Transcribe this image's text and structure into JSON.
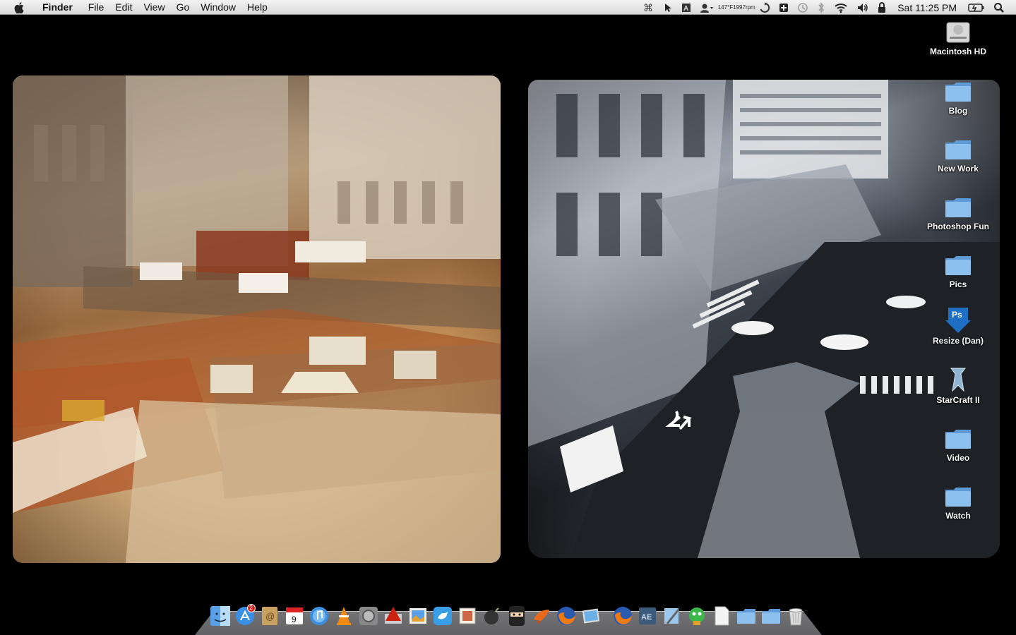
{
  "menubar": {
    "app_name": "Finder",
    "menus": [
      "File",
      "Edit",
      "View",
      "Go",
      "Window",
      "Help"
    ],
    "temp_line1": "147°F",
    "temp_line2": "1997rpm",
    "clock": "Sat 11:25 PM"
  },
  "desktop": {
    "icons": [
      {
        "label": "Macintosh HD",
        "icon": "hard-drive-icon"
      },
      {
        "label": "Blog",
        "icon": "folder-icon"
      },
      {
        "label": "New Work",
        "icon": "folder-icon"
      },
      {
        "label": "Photoshop Fun",
        "icon": "folder-icon"
      },
      {
        "label": "Pics",
        "icon": "folder-icon"
      },
      {
        "label": "Resize (Dan)",
        "icon": "photoshop-droplet-icon",
        "badge_text": "Ps"
      },
      {
        "label": "StarCraft II",
        "icon": "starcraft-icon"
      },
      {
        "label": "Video",
        "icon": "folder-icon"
      },
      {
        "label": "Watch",
        "icon": "folder-icon"
      }
    ]
  },
  "dock": {
    "appstore_badge": "2",
    "calendar_day": "9",
    "ae_label": "AE",
    "items": [
      "finder-icon",
      "app-store-icon",
      "address-book-icon",
      "ical-icon",
      "itunes-icon",
      "vlc-icon",
      "system-preferences-icon",
      "flash-icon",
      "preview-icon",
      "twitter-icon",
      "stamps-icon",
      "bomb-icon",
      "ninja-icon",
      "sparrow-icon",
      "firefox-icon",
      "iphoto-icon",
      "firefox-icon",
      "after-effects-icon",
      "xcode-icon",
      "adium-icon",
      "document-icon",
      "folder-icon",
      "folder-icon",
      "trash-icon"
    ]
  },
  "colors": {
    "menubar_top": "#f4f4f4",
    "menubar_bottom": "#d9d9d9",
    "desktop_bg": "#000000",
    "folder_blue": "#7fb6e8"
  }
}
